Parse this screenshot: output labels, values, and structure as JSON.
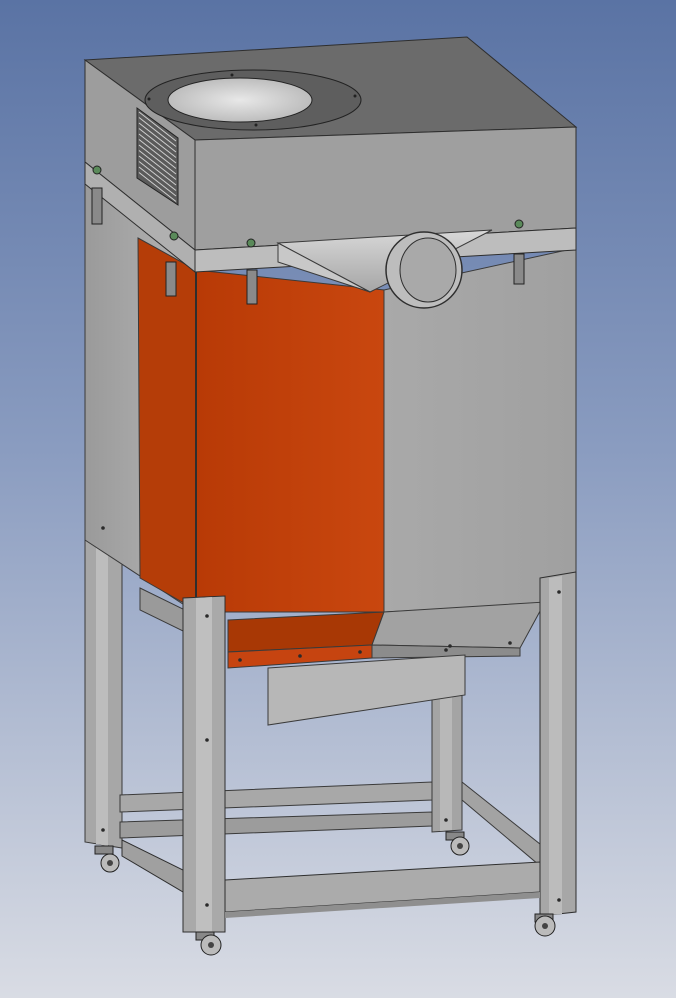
{
  "scene": {
    "subject": "",
    "colors": {
      "bg_top": "#6179a8",
      "bg_bottom": "#d6d9e2",
      "steel_light": "#b9b9b9",
      "steel_mid": "#a5a5a5",
      "steel_dark": "#8d8d8d",
      "steel_top": "#6c6c6c",
      "orange": "#c64410",
      "orange_dark": "#a83805",
      "edge": "#3a3a3a"
    }
  }
}
